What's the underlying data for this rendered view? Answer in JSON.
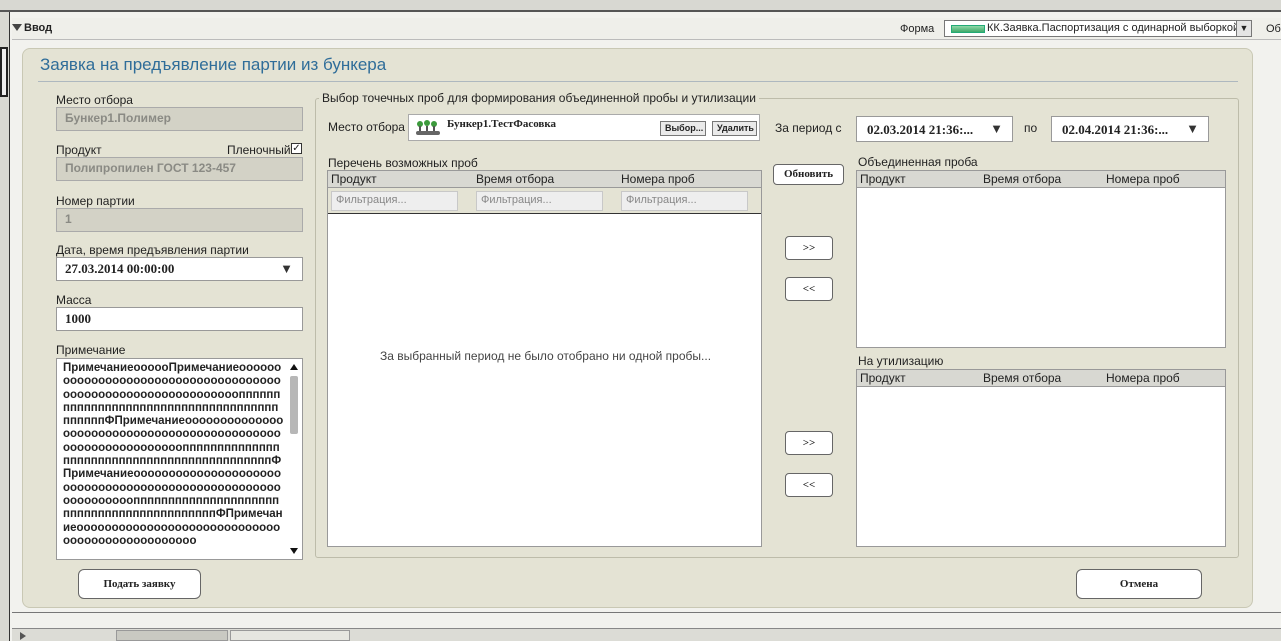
{
  "header": {
    "section_title": "Ввод",
    "forma_label": "Форма",
    "forma_value": "КК.Заявка.Паспортизация с одинарной выборкой",
    "cutoff_text": "Об"
  },
  "form": {
    "title": "Заявка на предъявление партии из бункера",
    "mesto_label": "Место отбора",
    "mesto_value": "Бункер1.Полимер",
    "product_label": "Продукт",
    "plenochny_label": "Пленочный",
    "plenochny_checked": true,
    "product_value": "Полипропилен ГОСТ 123-457",
    "party_label": "Номер партии",
    "party_value": "1",
    "date_label": "Дата, время предъявления партии",
    "date_value": "27.03.2014  00:00:00",
    "mass_label": "Масса",
    "mass_value": "1000",
    "note_label": "Примечание",
    "note_value": "ПримечаниеоооооПримечаниеоооооооооооооооооооооооооооооооооооооооооооооооооооооооооооооопппппппппппппппппппппппппппппппппппппппппппФПримечаниеооооооооооооооооооооооооооооооооооооооооооооооооооооооооооооооппппппппппппппппппппппппппппппппппппппппппппФПримечаниеоооооооооооооооооооооооооооооооооооооооооооооооооооооооооооооопппппппппппппппппппппппппппппппппппппппппппФПримечаниеоооооооооооооооооооооооооооооооооооооооооооооооо"
  },
  "selection": {
    "group_title": "Выбор точечных проб для формирования объединенной пробы и утилизации",
    "mesto_label": "Место отбора",
    "mesto_value": "Бункер1.ТестФасовка",
    "choose_button": "Выбор...",
    "delete_button": "Удалить",
    "period_label": "За период с",
    "date_from": "02.03.2014  21:36:...",
    "to_label": "по",
    "date_to": "02.04.2014  21:36:...",
    "refresh_button": "Обновить",
    "possible_title": "Перечень возможных проб",
    "columns": [
      "Продукт",
      "Время отбора",
      "Номера проб"
    ],
    "filter_placeholder": "Фильтрация...",
    "empty_message": "За выбранный период не было отобрано ни одной пробы...",
    "move_right": ">>",
    "move_left": "<<",
    "combined_title": "Объединенная проба",
    "utilization_title": "На утилизацию"
  },
  "actions": {
    "submit": "Подать заявку",
    "cancel": "Отмена"
  },
  "icons": {
    "collapse": "triangle-down-icon",
    "dropdown": "chevron-down-icon",
    "checkbox": "checkbox-checked-icon",
    "location": "sampler-icon"
  },
  "colors": {
    "title_blue": "#2f6d99",
    "panel_bg": "#e4e3d4",
    "indicator_green": "#3fa96a"
  }
}
